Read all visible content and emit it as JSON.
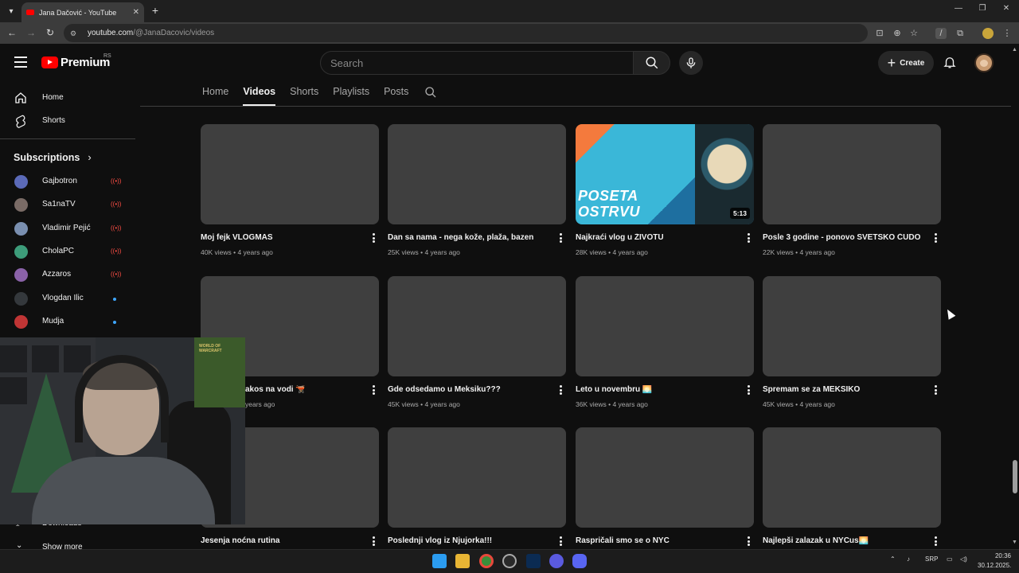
{
  "browser": {
    "tab_title": "Jana Dačović - YouTube",
    "url_host": "youtube.com",
    "url_path": "/@JanaDacovic/videos"
  },
  "masthead": {
    "logo_text": "Premium",
    "country_code": "RS",
    "search_placeholder": "Search",
    "create_label": "Create"
  },
  "sidebar": {
    "items": [
      {
        "label": "Home",
        "icon": "home-icon"
      },
      {
        "label": "Shorts",
        "icon": "shorts-icon"
      }
    ],
    "subscriptions_label": "Subscriptions",
    "subscriptions": [
      {
        "name": "Gajbotron",
        "status": "live",
        "color": "#5b6ab8"
      },
      {
        "name": "Sa1naTV",
        "status": "live",
        "color": "#7a6b66"
      },
      {
        "name": "Vladimir Pejić",
        "status": "live",
        "color": "#7a8fb0"
      },
      {
        "name": "CholaPC",
        "status": "live",
        "color": "#3d9c7a"
      },
      {
        "name": "Azzaros",
        "status": "live",
        "color": "#8a62a8"
      },
      {
        "name": "Vlogdan Ilic",
        "status": "new",
        "color": "#34383c"
      },
      {
        "name": "Mudja",
        "status": "new",
        "color": "#c03535"
      }
    ],
    "bottom_items": [
      {
        "label": "Downloads",
        "icon": "download-icon"
      },
      {
        "label": "Show more",
        "icon": "chevron-down-icon"
      }
    ]
  },
  "channel_tabs": [
    {
      "label": "Home",
      "active": false
    },
    {
      "label": "Videos",
      "active": true
    },
    {
      "label": "Shorts",
      "active": false
    },
    {
      "label": "Playlists",
      "active": false
    },
    {
      "label": "Posts",
      "active": false
    }
  ],
  "videos": [
    {
      "title": "Moj fejk VLOGMAS",
      "views": "40K views",
      "age": "4 years ago"
    },
    {
      "title": "Dan sa nama - nega kože, plaža, bazen",
      "views": "25K views",
      "age": "4 years ago"
    },
    {
      "title": "Najkraći vlog u ŽIVOTU",
      "views": "28K views",
      "age": "4 years ago",
      "duration": "5:13",
      "thumb_text": [
        "POSETA",
        "OSTRVU"
      ]
    },
    {
      "title": "Posle 3 godine - ponovo SVETSKO ČUDO",
      "views": "22K views",
      "age": "4 years ago"
    },
    {
      "title": "Dorucak na vodi 🫕",
      "visible_title": "akos na vodi 🫕",
      "views": "",
      "age": "years ago"
    },
    {
      "title": "Gde odsedamo u Meksiku???",
      "views": "45K views",
      "age": "4 years ago"
    },
    {
      "title": "Leto u novembru 🌅",
      "views": "36K views",
      "age": "4 years ago"
    },
    {
      "title": "Spremam se za MEKSIKO",
      "views": "45K views",
      "age": "4 years ago"
    },
    {
      "title": "Jesenja noćna rutina",
      "views": "",
      "age": ""
    },
    {
      "title": "Poslednji vlog iz Njujorka!!!",
      "views": "",
      "age": ""
    },
    {
      "title": "Raspričali smo se o NYC",
      "views": "",
      "age": ""
    },
    {
      "title": "Najlepši zalazak u NYCus🌅",
      "views": "",
      "age": ""
    }
  ],
  "webcam": {
    "poster_text": "WORLD OF WARCRAFT"
  },
  "taskbar": {
    "language": "SRP",
    "time": "20:36",
    "date": "30.12.2025."
  },
  "colors": {
    "youtube_red": "#ff0000",
    "background": "#0f0f0f",
    "placeholder_thumb": "#3f3f3f",
    "thumb_accent": "#f47a3d"
  }
}
